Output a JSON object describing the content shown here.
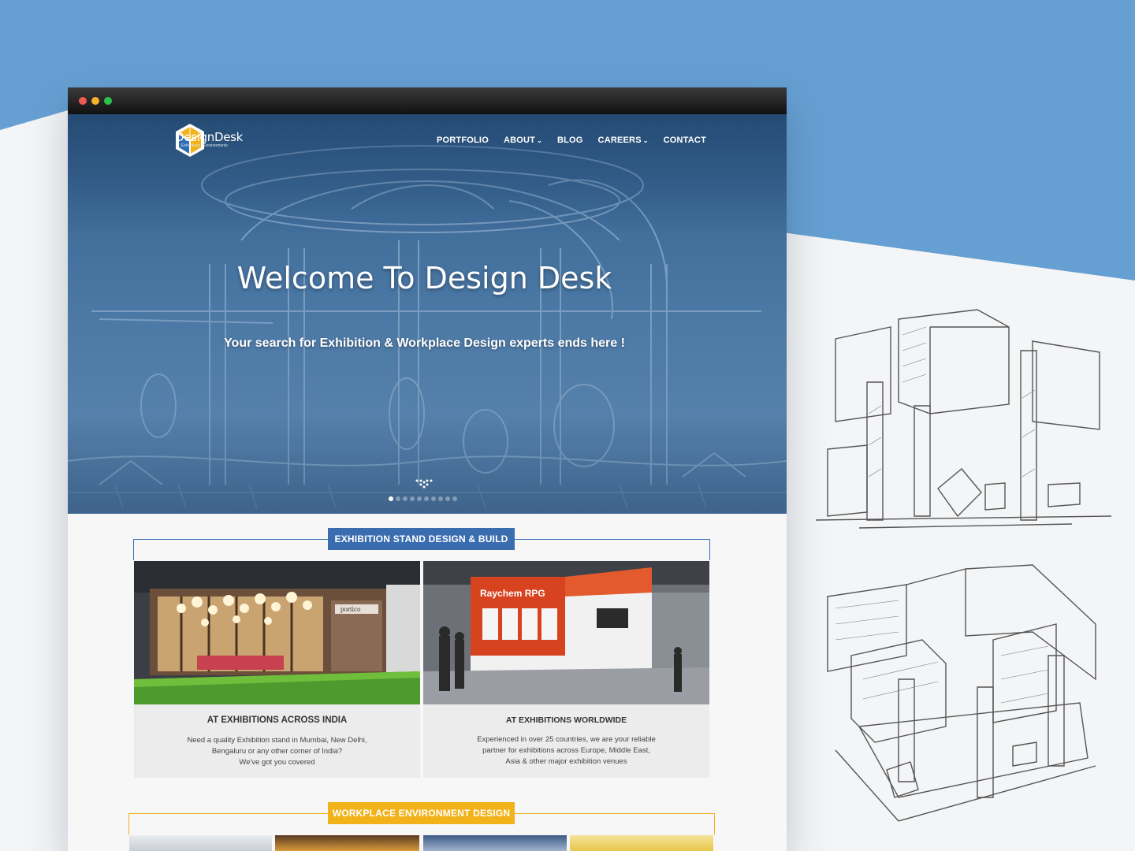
{
  "window": {
    "controls": [
      "close",
      "minimize",
      "maximize"
    ]
  },
  "brand": {
    "name": "DesignDesk",
    "tagline": "Exhibitions | Environments"
  },
  "nav": {
    "items": [
      {
        "label": "PORTFOLIO",
        "dropdown": false
      },
      {
        "label": "ABOUT",
        "dropdown": true
      },
      {
        "label": "BLOG",
        "dropdown": false
      },
      {
        "label": "CAREERS",
        "dropdown": true
      },
      {
        "label": "CONTACT",
        "dropdown": false
      }
    ]
  },
  "hero": {
    "title": "Welcome To Design Desk",
    "subtitle": "Your search for Exhibition & Workplace Design experts ends here !",
    "slider_dots": 10,
    "active_slide": 1
  },
  "exhibition": {
    "label": "EXHIBITION STAND DESIGN & BUILD",
    "cards": [
      {
        "title": "AT EXHIBITIONS ACROSS INDIA",
        "lines": [
          "Need a quality Exhibition stand in Mumbai, New Delhi,",
          "Bengaluru or any other corner of India?",
          "We've got you covered"
        ]
      },
      {
        "title": "AT EXHIBITIONS WORLDWIDE",
        "lines": [
          "Experienced in over 25 countries, we are your reliable",
          "partner for exhibitions across Europe, Middle East,",
          "Asia & other major exhibition venues"
        ]
      }
    ],
    "booth_brands": [
      "portico",
      "Raychem RPG"
    ]
  },
  "workplace": {
    "label": "WORKPLACE ENVIRONMENT DESIGN"
  },
  "colors": {
    "background_blue": "#66a0d3",
    "accent_blue": "#3a6db0",
    "accent_yellow": "#f1b21a",
    "hero_blue": "#3f6c98"
  }
}
